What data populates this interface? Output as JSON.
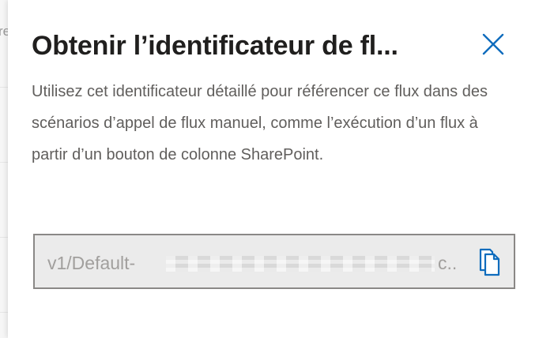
{
  "backdrop": {
    "partial_text": "re"
  },
  "panel": {
    "title": "Obtenir l’identificateur de fl...",
    "description": "Utilisez cet identificateur détaillé pour référencer ce flux dans des scénarios d’appel de flux manuel, comme l’exécution d’un flux à partir d’un bouton de colonne SharePoint.",
    "close_icon": "close-icon",
    "identifier": {
      "prefix": "v1/Default-",
      "suffix": "c...",
      "copy_icon": "copy-icon"
    }
  },
  "colors": {
    "accent": "#0f6cbd",
    "title_text": "#201f1e",
    "body_text": "#605e5c",
    "field_background": "#ebebeb",
    "field_border": "#8a8886",
    "field_text": "#a19f9d"
  }
}
